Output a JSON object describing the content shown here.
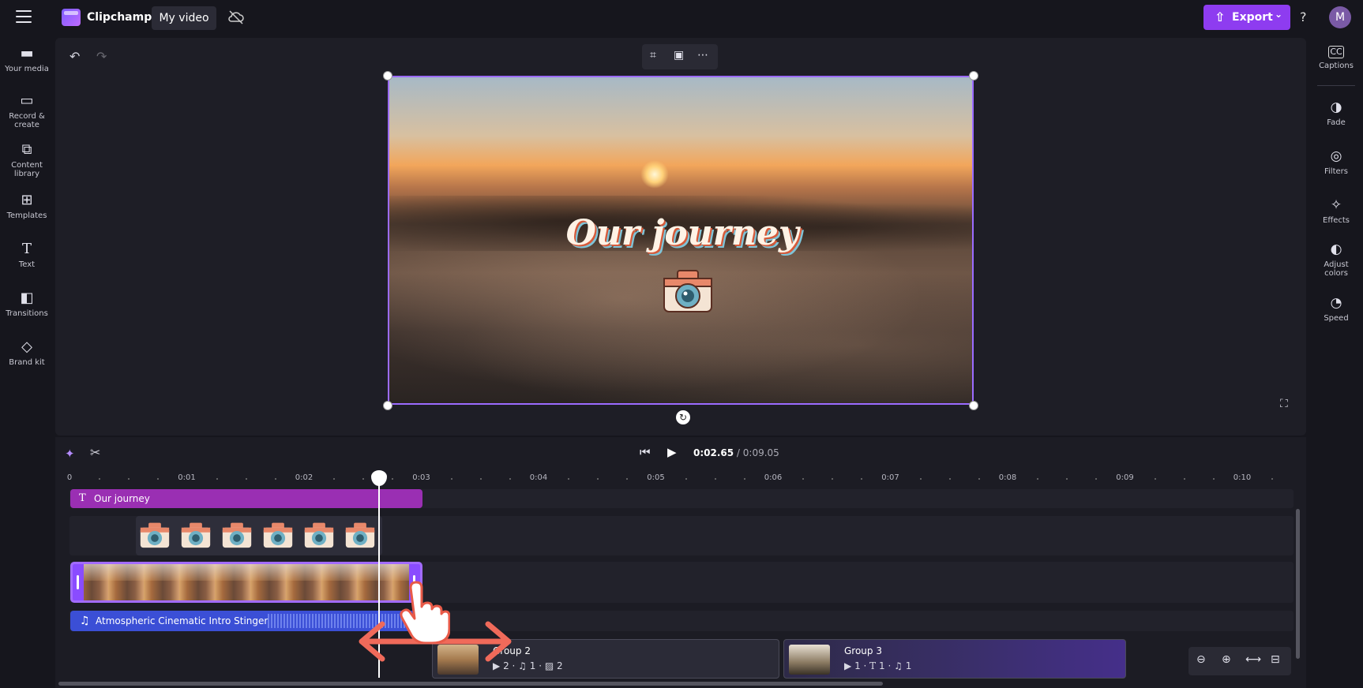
{
  "header": {
    "app_name": "Clipchamp",
    "project_name": "My video",
    "export_label": "Export",
    "help_label": "?",
    "avatar_initial": "M"
  },
  "left_nav": [
    {
      "label": "Your media",
      "icon": "folder-icon"
    },
    {
      "label": "Record &\ncreate",
      "icon": "camera-icon"
    },
    {
      "label": "Content\nlibrary",
      "icon": "library-icon"
    },
    {
      "label": "Templates",
      "icon": "templates-icon"
    },
    {
      "label": "Text",
      "icon": "text-icon"
    },
    {
      "label": "Transitions",
      "icon": "transitions-icon"
    },
    {
      "label": "Brand kit",
      "icon": "brand-kit-icon"
    }
  ],
  "right_nav": [
    {
      "label": "Captions",
      "icon": "captions-icon"
    },
    {
      "label": "Fade",
      "icon": "fade-icon"
    },
    {
      "label": "Filters",
      "icon": "filters-icon"
    },
    {
      "label": "Effects",
      "icon": "effects-icon"
    },
    {
      "label": "Adjust\ncolors",
      "icon": "adjust-colors-icon"
    },
    {
      "label": "Speed",
      "icon": "speed-icon"
    }
  ],
  "preview": {
    "overlay_title": "Our journey"
  },
  "playback": {
    "current_time": "0:02.65",
    "separator": " / ",
    "duration": "0:09.05"
  },
  "ruler": {
    "labels": [
      "0",
      "0:01",
      "0:02",
      "0:03",
      "0:04",
      "0:05",
      "0:06",
      "0:07",
      "0:08",
      "0:09",
      "0:10"
    ]
  },
  "tracks": {
    "text_clip": "Our journey",
    "audio_clip": "Atmospheric Cinematic Intro Stinger"
  },
  "groups": [
    {
      "name": "Group 2",
      "video_count": "2",
      "audio_count": "1",
      "image_count": "2"
    },
    {
      "name": "Group 3",
      "video_count": "1",
      "text_count": "1",
      "audio_count": "1"
    }
  ],
  "colors": {
    "accent": "#8e3cf0",
    "text_clip": "#9a2fb3",
    "audio_clip": "#3b4fd6",
    "selection": "#9b6bff"
  }
}
